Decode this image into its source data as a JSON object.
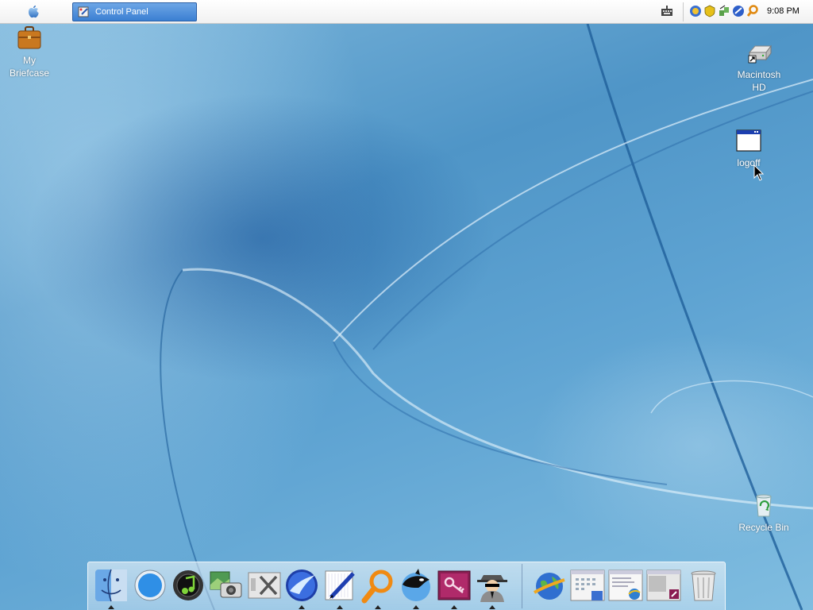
{
  "menubar": {
    "task_button": "Control Panel",
    "clock": "9:08 PM",
    "tray_icons": [
      "shield-icon",
      "network-icon",
      "globe-icon",
      "search-icon",
      "antivirus-icon"
    ]
  },
  "desktop": {
    "icons": [
      {
        "name": "briefcase",
        "label_line1": "My",
        "label_line2": "Briefcase"
      },
      {
        "name": "macintosh-hd",
        "label_line1": "Macintosh",
        "label_line2": "HD"
      },
      {
        "name": "logoff",
        "label_line1": "logoff"
      },
      {
        "name": "recycle-bin",
        "label_line1": "Recycle Bin"
      }
    ]
  },
  "dock": {
    "items": [
      "finder-icon",
      "safari-icon",
      "itunes-icon",
      "iphoto-icon",
      "tools-icon",
      "sleipnir-icon",
      "textedit-icon",
      "search-icon",
      "orca-icon",
      "keychain-icon",
      "spy-icon",
      "network-globe-icon",
      "calendar-window-icon",
      "ie-window-icon",
      "window-shortcut-icon",
      "trash-icon"
    ]
  },
  "colors": {
    "accent": "#3b7fd2",
    "desktop_blue": "#5ea3d2"
  }
}
